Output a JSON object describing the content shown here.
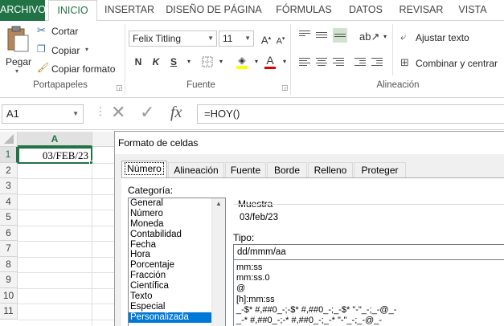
{
  "ribbon_tabs": [
    "ARCHIVO",
    "INICIO",
    "INSERTAR",
    "DISEÑO DE PÁGINA",
    "FÓRMULAS",
    "DATOS",
    "REVISAR",
    "VISTA"
  ],
  "portapapeles": {
    "paste_label": "Pegar",
    "cut_label": "Cortar",
    "copy_label": "Copiar",
    "format_painter_label": "Copiar formato",
    "group_label": "Portapapeles"
  },
  "fuente": {
    "font_name": "Felix Titling",
    "font_size": "11",
    "bold": "N",
    "italic": "K",
    "underline": "S",
    "grow": "A",
    "shrink": "A",
    "font_color_letter": "A",
    "group_label": "Fuente",
    "highlight_color": "#ffff00",
    "font_color": "#e00000"
  },
  "alineacion": {
    "wrap_label": "Ajustar texto",
    "merge_label": "Combinar y centrar",
    "group_label": "Alineación"
  },
  "formula_bar": {
    "name_box": "A1",
    "fx_label": "fx",
    "formula": "=HOY()"
  },
  "grid": {
    "columns": [
      "A"
    ],
    "rows": [
      "1",
      "2",
      "3",
      "4",
      "5",
      "6",
      "7",
      "8",
      "9",
      "10",
      "11"
    ],
    "a1_value": "03/FEB/23"
  },
  "dialog": {
    "title": "Formato de celdas",
    "tabs": [
      "Número",
      "Alineación",
      "Fuente",
      "Borde",
      "Relleno",
      "Proteger"
    ],
    "category_label": "Categoría:",
    "categories": [
      "General",
      "Número",
      "Moneda",
      "Contabilidad",
      "Fecha",
      "Hora",
      "Porcentaje",
      "Fracción",
      "Científica",
      "Texto",
      "Especial",
      "Personalizada"
    ],
    "selected_category": "Personalizada",
    "sample_label": "Muestra",
    "sample_value": "03/feb/23",
    "type_label": "Tipo:",
    "type_value": "dd/mmm/aa",
    "format_codes": [
      "mm:ss",
      "mm:ss.0",
      "@",
      "[h]:mm:ss",
      "_-$* #,##0_-;-$* #,##0_-;_-$* \"-\"_-;_-@_-",
      "_-* #,##0_-;-* #,##0_-;_-* \"-\"_-;_-@_-"
    ]
  },
  "colors": {
    "excel_green": "#217346",
    "selection_blue": "#0078d7"
  }
}
